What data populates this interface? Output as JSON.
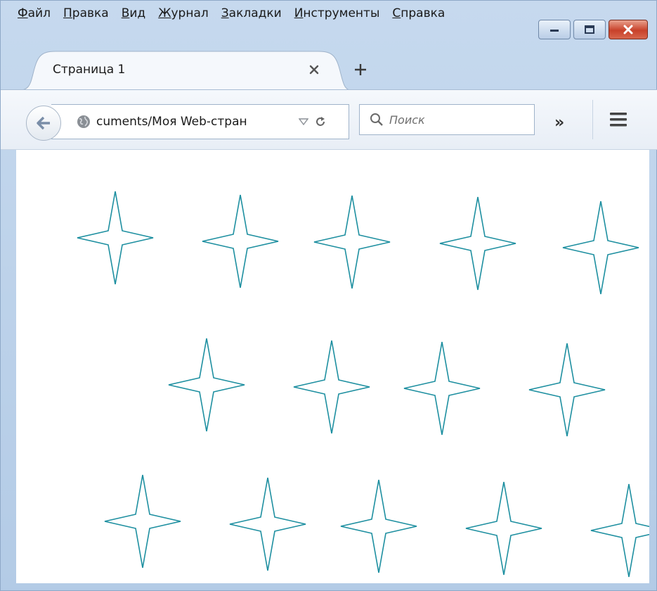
{
  "menubar": {
    "items": [
      {
        "accel": "Ф",
        "rest": "айл"
      },
      {
        "accel": "П",
        "rest": "равка"
      },
      {
        "accel": "В",
        "rest": "ид"
      },
      {
        "accel": "Ж",
        "rest": "урнал"
      },
      {
        "accel": "З",
        "rest": "акладки"
      },
      {
        "accel": "И",
        "rest": "нструменты"
      },
      {
        "accel": "С",
        "rest": "правка"
      }
    ]
  },
  "window_controls": [
    "minimize-icon",
    "maximize-icon",
    "close-icon"
  ],
  "tab": {
    "title": "Страница 1",
    "close_icon": "close-icon",
    "new_tab_icon": "plus-icon"
  },
  "navbar": {
    "back_icon": "back-arrow-icon",
    "url": "cuments/Моя Web-стран",
    "site_icon": "globe-icon",
    "dropdown_icon": "triangle-down-icon",
    "reload_icon": "reload-icon",
    "search_placeholder": "Поиск",
    "overflow_label": "»",
    "menu_icon": "hamburger-icon"
  },
  "content": {
    "star_color": "#1d8fa0",
    "star_count": 14,
    "rows": [
      5,
      4,
      5
    ]
  }
}
